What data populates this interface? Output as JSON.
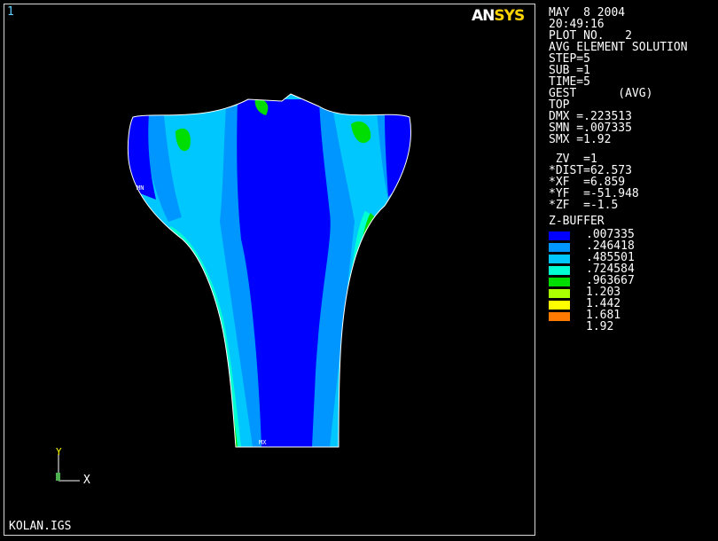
{
  "window_number": "1",
  "logo": {
    "part1": "AN",
    "part2": "SYS"
  },
  "info_lines": [
    "MAY  8 2004",
    "20:49:16",
    "PLOT NO.   2",
    "AVG ELEMENT SOLUTION",
    "STEP=5",
    "SUB =1",
    "TIME=5",
    "GEST      (AVG)",
    "TOP",
    "DMX =.223513",
    "SMN =.007335",
    "SMX =1.92"
  ],
  "view_lines": [
    " ZV  =1",
    "*DIST=62.573",
    "*XF  =6.859",
    "*YF  =-51.948",
    "*ZF  =-1.5"
  ],
  "legend": {
    "title": "Z-BUFFER",
    "values": [
      ".007335",
      ".246418",
      ".485501",
      ".724584",
      ".963667",
      "1.203",
      "1.442",
      "1.681",
      "1.92"
    ],
    "colors": [
      "#0000ff",
      "#0096ff",
      "#00c8ff",
      "#00ffd2",
      "#00dd00",
      "#aaff00",
      "#ffff00",
      "#ff7a00",
      "#ff0000"
    ]
  },
  "model_labels": {
    "min": "MN",
    "max": "MX"
  },
  "triad": {
    "x": "X",
    "y": "Y"
  },
  "filename": "KOLAN.IGS"
}
